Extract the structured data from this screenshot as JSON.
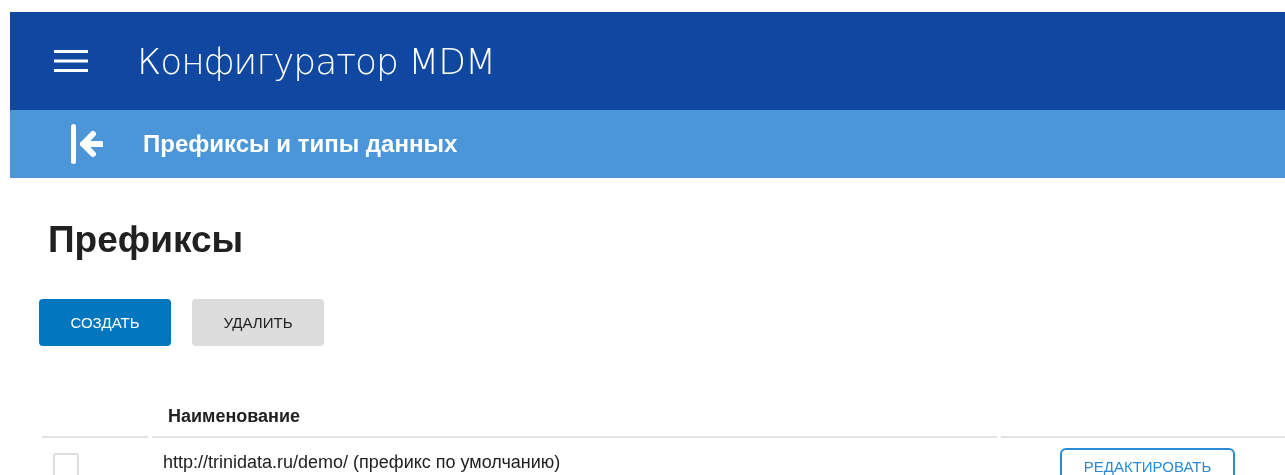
{
  "app_bar": {
    "title": "Конфигуратор MDM"
  },
  "sub_bar": {
    "title": "Префиксы и типы данных"
  },
  "page": {
    "heading": "Префиксы"
  },
  "actions": [
    {
      "label": "СОЗДАТЬ",
      "kind": "primary"
    },
    {
      "label": "УДАЛИТЬ",
      "kind": "secondary"
    }
  ],
  "table": {
    "columns": [
      "Наименование"
    ],
    "rows": [
      {
        "checked": false,
        "name": "http://trinidata.ru/demo/ (префикс по умолчанию)",
        "action": "РЕДАКТИРОВАТЬ"
      }
    ]
  }
}
